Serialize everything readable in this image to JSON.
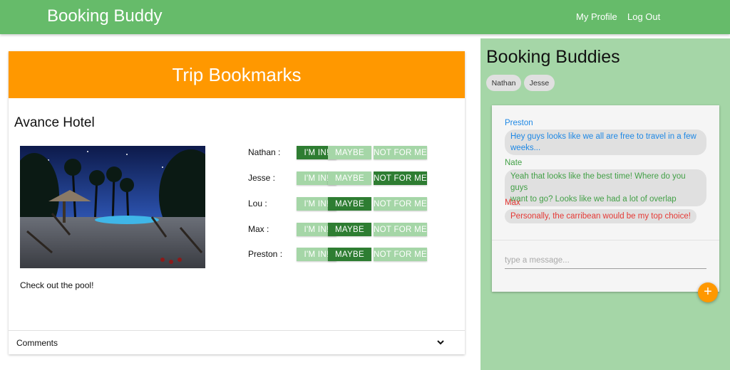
{
  "app": {
    "brand": "Booking Buddy"
  },
  "nav": {
    "profile": "My Profile",
    "logout": "Log Out"
  },
  "main": {
    "header": "Trip Bookmarks",
    "hotel_name": "Avance Hotel",
    "caption": "Check out the pool!",
    "vote_labels": {
      "in": "I'M IN!",
      "maybe": "MAYBE",
      "no": "NOT FOR ME"
    },
    "votes": [
      {
        "name": "Nathan :",
        "choice": "in"
      },
      {
        "name": "Jesse :",
        "choice": "no"
      },
      {
        "name": "Lou :",
        "choice": "maybe"
      },
      {
        "name": "Max :",
        "choice": "maybe"
      },
      {
        "name": "Preston :",
        "choice": "maybe"
      }
    ],
    "comments_label": "Comments"
  },
  "sidebar": {
    "title": "Booking Buddies",
    "chips": [
      "Nathan",
      "Jesse"
    ],
    "messages": [
      {
        "sender": "Preston",
        "text_lines": [
          "Hey guys looks like we all are free to travel in a few",
          "weeks..."
        ],
        "color": "#1e88e5"
      },
      {
        "sender": "Nate",
        "text_lines": [
          "Yeah that looks like the best time! Where do you guys",
          "want to go? Looks like we had a lot of overlap"
        ],
        "color": "#43a047"
      },
      {
        "sender": "Max",
        "text_lines": [
          "Personally, the carribean would be my top choice!"
        ],
        "color": "#e53935"
      }
    ],
    "input_placeholder": "type a message...",
    "add_icon": "plus-icon"
  },
  "colors": {
    "topbar": "#66bb6a",
    "header": "#ff9800",
    "vote_selected": "#2e7d32",
    "vote_unselected": "#a5d6a7",
    "sidebar_bg": "#a5d6a7"
  }
}
